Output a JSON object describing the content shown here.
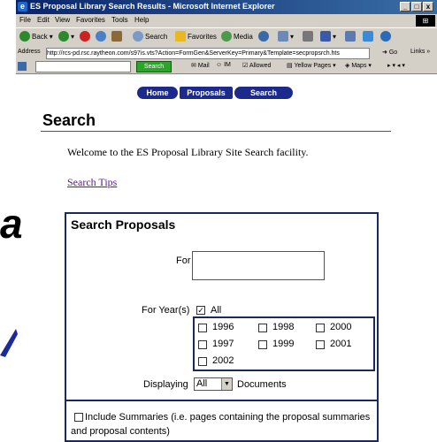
{
  "window": {
    "title": "ES Proposal Library Search Results - Microsoft Internet Explorer",
    "minimize": "_",
    "maximize": "□",
    "close": "x"
  },
  "menu": [
    "File",
    "Edit",
    "View",
    "Favorites",
    "Tools",
    "Help"
  ],
  "toolbar": {
    "back": "Back",
    "search": "Search",
    "favorites": "Favorites",
    "media": "Media"
  },
  "address": {
    "label": "Address",
    "url": "http://rcs-pd.rsc.raytheon.com/s97is.vts?Action=FormGen&ServerKey=Primary&Template=secpropsrch.hts",
    "go": "Go",
    "links": "Links"
  },
  "links_bar": {
    "search_button": "Search",
    "mail": "Mail",
    "im": "IM",
    "allowed": "Allowed",
    "yellow_pages": "Yellow Pages",
    "maps": "Maps"
  },
  "nav": {
    "home": "Home",
    "proposals": "Proposals",
    "search": "Search"
  },
  "page": {
    "title": "Search",
    "welcome": "Welcome to the ES Proposal Library Site Search facility.",
    "search_tips": "Search Tips"
  },
  "form": {
    "panel_title": "Search Proposals",
    "for_label": "For",
    "for_value": "",
    "year_label": "For Year(s)",
    "all_label": "All",
    "all_checked": true,
    "years": [
      {
        "label": "1996",
        "checked": false
      },
      {
        "label": "1998",
        "checked": false
      },
      {
        "label": "2000",
        "checked": false
      },
      {
        "label": "1997",
        "checked": false
      },
      {
        "label": "1999",
        "checked": false
      },
      {
        "label": "2001",
        "checked": false
      },
      {
        "label": "2002",
        "checked": false
      }
    ],
    "displaying_label": "Displaying",
    "displaying_value": "All",
    "documents_label": "Documents",
    "summaries_label": "Include Summaries (i.e. pages containing the proposal summaries and proposal contents)",
    "summaries_checked": false
  },
  "fragment": {
    "letter": "a"
  },
  "colors": {
    "nav_bg": "#1c2a8c",
    "panel_border": "#1b2a5e",
    "link_visited": "#551a8b"
  }
}
